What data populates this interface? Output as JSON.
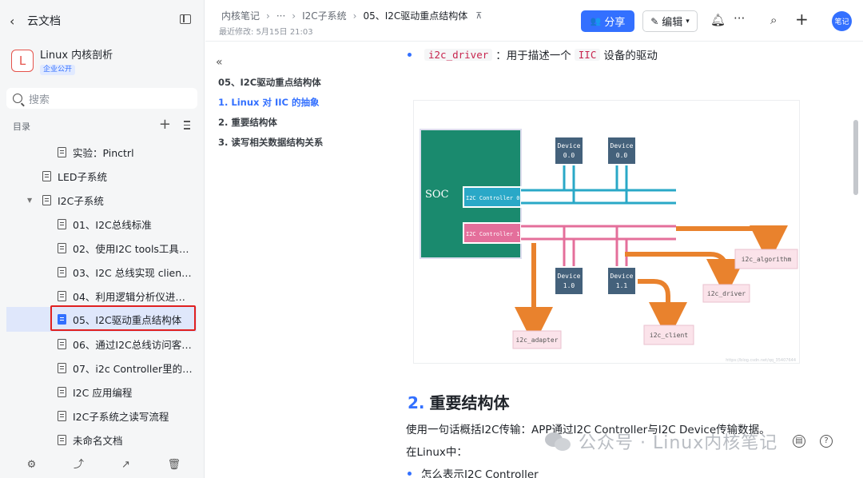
{
  "sidebar": {
    "back_label": "云文档",
    "kb_logo": "L",
    "kb_name": "Linux 内核剖析",
    "kb_badge": "企业公开",
    "search_placeholder": "搜索",
    "toc_label": "目录",
    "items": [
      {
        "label": "实验：Pinctrl",
        "level": 2
      },
      {
        "label": "LED子系统",
        "level": 1
      },
      {
        "label": "I2C子系统",
        "level": 1,
        "expanded": true
      },
      {
        "label": "01、I2C总线标准",
        "level": 2
      },
      {
        "label": "02、使用I2C tools工具调...",
        "level": 2
      },
      {
        "label": "03、I2C 总线实现 client 设...",
        "level": 2
      },
      {
        "label": "04、利用逻辑分析仪进行I...",
        "level": 2
      },
      {
        "label": "05、I2C驱动重点结构体",
        "level": 2,
        "active": true
      },
      {
        "label": "06、通过I2C总线访问客户...",
        "level": 2
      },
      {
        "label": "07、i2c Controller里的注册...",
        "level": 2
      },
      {
        "label": "I2C 应用编程",
        "level": 2
      },
      {
        "label": "I2C子系统之读写流程",
        "level": 2
      },
      {
        "label": "未命名文档",
        "level": 2
      }
    ],
    "bottom_icons": [
      "gear-icon",
      "share-out-icon",
      "chart-icon",
      "trash-icon"
    ]
  },
  "header": {
    "breadcrumb": [
      "内核笔记",
      "···",
      "I2C子系统",
      "05、I2C驱动重点结构体"
    ],
    "modified": "最近修改: 5月15日 21:03",
    "share_label": "分享",
    "edit_label": "编辑",
    "avatar_text": "笔记",
    "accent": "#3370ff"
  },
  "outline": {
    "items": [
      {
        "label": "05、I2C驱动重点结构体",
        "active": false
      },
      {
        "label": "1. Linux 对 IIC 的抽象",
        "active": true
      },
      {
        "label": "2. 重要结构体",
        "active": false
      },
      {
        "label": "3. 读写相关数据结构关系",
        "active": false
      }
    ]
  },
  "content": {
    "bullet1_code1": "i2c_driver",
    "bullet1_text": "：用于描述一个",
    "bullet1_code2": "IIC",
    "bullet1_text2": "设备的驱动",
    "diagram": {
      "soc": "SOC",
      "ctrl0": "I2C Controller 0",
      "ctrl1": "I2C Controller 1",
      "dev00a": "Device",
      "dev00a_n": "0.0",
      "dev00b": "Device",
      "dev00b_n": "0.0",
      "dev10": "Device",
      "dev10_n": "1.0",
      "dev11": "Device",
      "dev11_n": "1.1",
      "i2c_algorithm": "i2c_algorithm",
      "i2c_driver": "i2c_driver",
      "i2c_client": "i2c_client",
      "i2c_adapter": "i2c_adapter",
      "credit": "https://blog.csdn.net/qq_35407644"
    },
    "h2_num": "2.",
    "h2_text": "重要结构体",
    "para1": "使用一句话概括I2C传输：APP通过I2C Controller与I2C Device传输数据。",
    "para2": "在Linux中：",
    "bullet2": "怎么表示I2C Controller",
    "watermark": "公众号 · Linux内核笔记"
  }
}
